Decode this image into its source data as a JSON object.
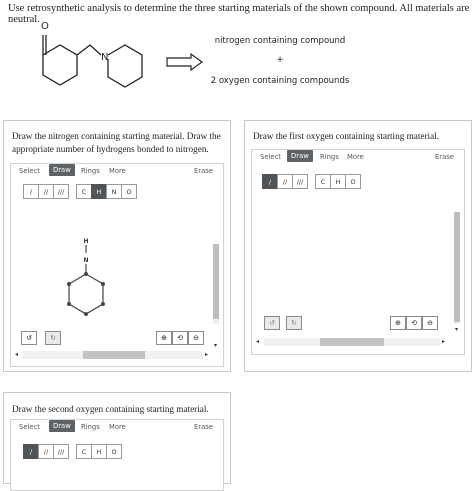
{
  "question": {
    "intro": "Use retrosynthetic analysis to determine the three starting materials of the shown compound. All materials are neutral.",
    "nitrogen_label": "nitrogen containing compound",
    "plus": "+",
    "oxygen_label": "2 oxygen containing compounds",
    "molecule_atoms": {
      "o": "O",
      "n": "N"
    }
  },
  "panels": {
    "left": {
      "prompt": "Draw the nitrogen containing starting material. Draw the appropriate number of hydrogens bonded to nitrogen."
    },
    "right": {
      "prompt": "Draw the first oxygen containing starting material."
    },
    "bottom": {
      "prompt": "Draw the second oxygen containing starting material."
    }
  },
  "toolbar": {
    "select": "Select",
    "draw": "Draw",
    "rings": "Rings",
    "more": "More",
    "erase": "Erase",
    "bond_single": "/",
    "bond_double": "//",
    "bond_triple": "///",
    "atoms_left": [
      "C",
      "H",
      "N",
      "O"
    ],
    "atoms_oxy": [
      "C",
      "H",
      "O"
    ]
  },
  "canvas": {
    "atom_h": "H",
    "atom_n": "N"
  },
  "controls": {
    "undo": "↺",
    "redo": "↻",
    "zoom_in": "⊕",
    "reset": "⟲",
    "zoom_out": "⊖",
    "scroll_left": "◂",
    "scroll_right": "▸",
    "scroll_down": "▾"
  },
  "colors": {
    "active_tab": "#5d6266",
    "selected_tool": "#4f5458",
    "border": "#c8c8c8"
  }
}
